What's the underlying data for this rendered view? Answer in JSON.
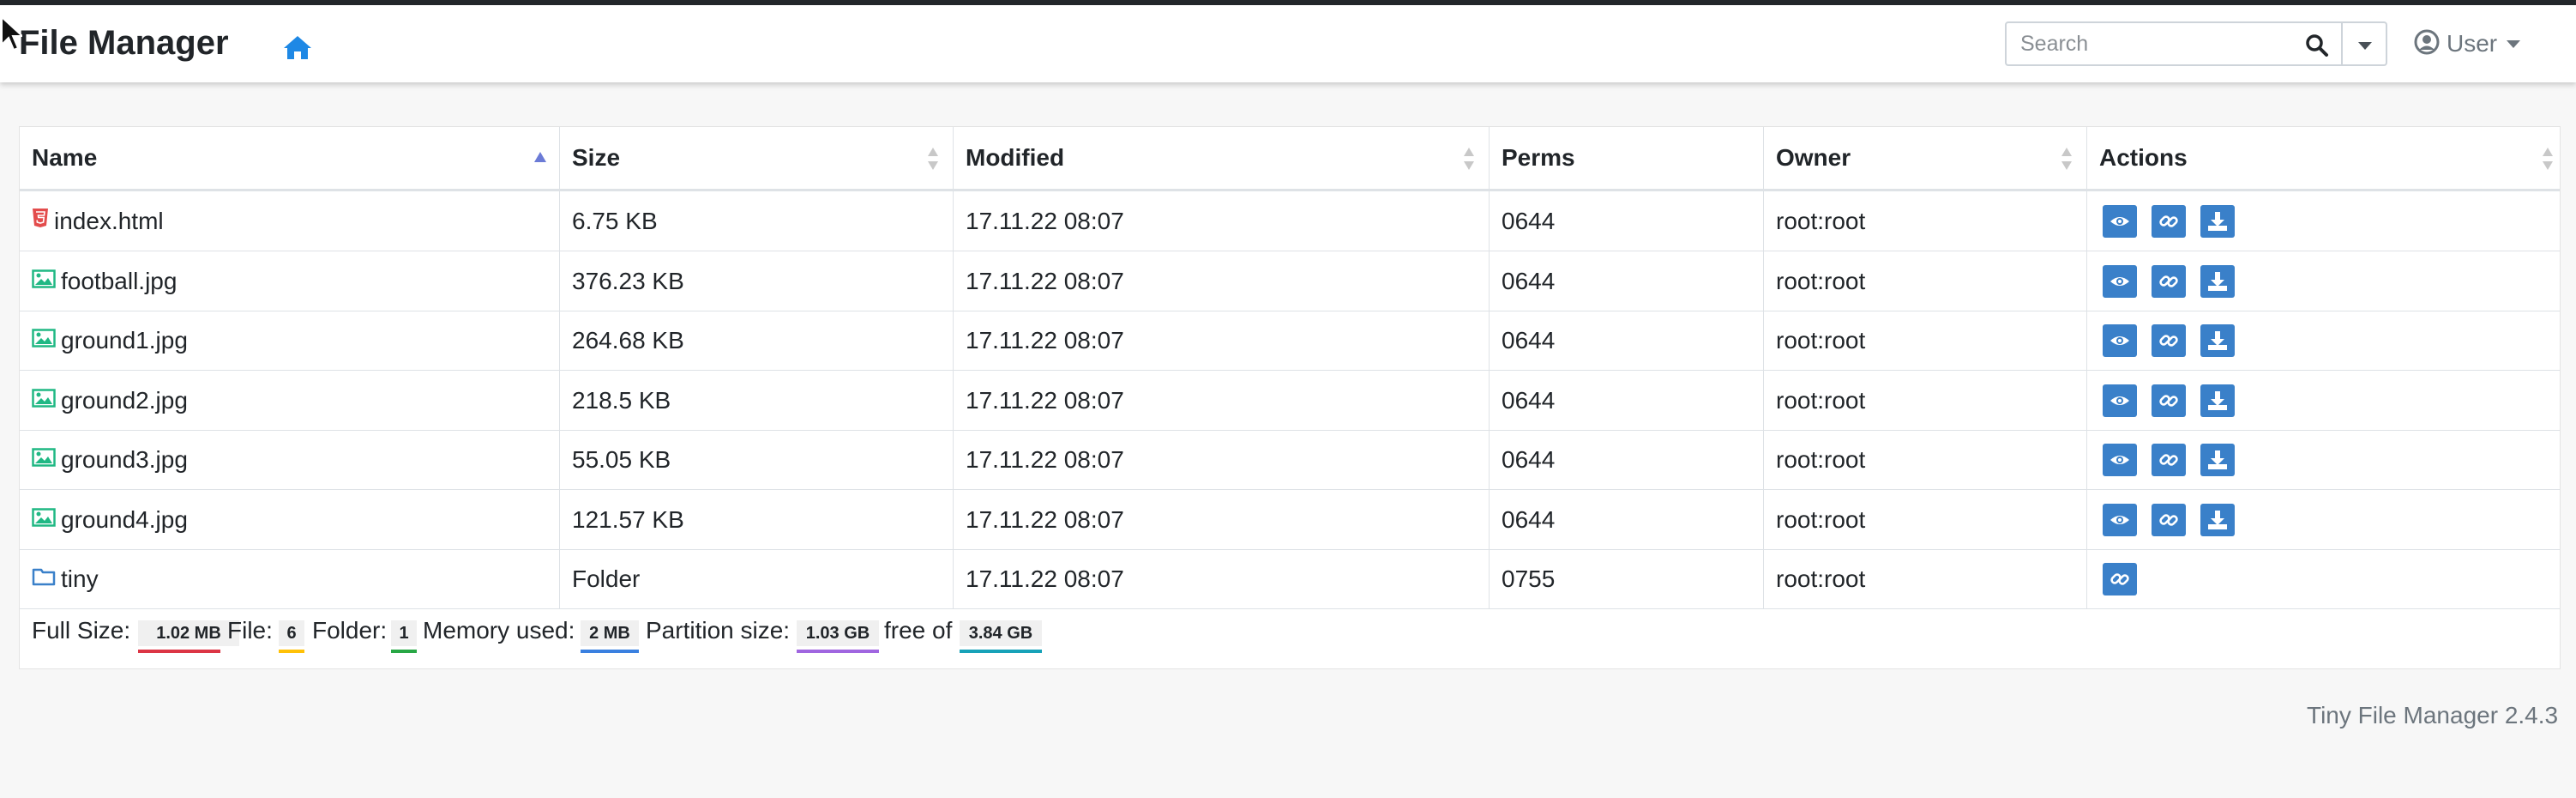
{
  "app": {
    "title": "File Manager"
  },
  "search": {
    "placeholder": "Search",
    "value": ""
  },
  "user_menu": {
    "label": "User"
  },
  "table": {
    "headers": {
      "name": "Name",
      "size": "Size",
      "modified": "Modified",
      "perms": "Perms",
      "owner": "Owner",
      "actions": "Actions"
    },
    "rows": [
      {
        "icon": "html-file-icon",
        "name": "index.html",
        "size": "6.75 KB",
        "modified": "17.11.22 08:07",
        "perms": "0644",
        "owner": "root:root"
      },
      {
        "icon": "image-file-icon",
        "name": "football.jpg",
        "size": "376.23 KB",
        "modified": "17.11.22 08:07",
        "perms": "0644",
        "owner": "root:root"
      },
      {
        "icon": "image-file-icon",
        "name": "ground1.jpg",
        "size": "264.68 KB",
        "modified": "17.11.22 08:07",
        "perms": "0644",
        "owner": "root:root"
      },
      {
        "icon": "image-file-icon",
        "name": "ground2.jpg",
        "size": "218.5 KB",
        "modified": "17.11.22 08:07",
        "perms": "0644",
        "owner": "root:root"
      },
      {
        "icon": "image-file-icon",
        "name": "ground3.jpg",
        "size": "55.05 KB",
        "modified": "17.11.22 08:07",
        "perms": "0644",
        "owner": "root:root"
      },
      {
        "icon": "image-file-icon",
        "name": "ground4.jpg",
        "size": "121.57 KB",
        "modified": "17.11.22 08:07",
        "perms": "0644",
        "owner": "root:root"
      },
      {
        "icon": "folder-icon",
        "name": "tiny",
        "size": "Folder",
        "modified": "17.11.22 08:07",
        "perms": "0755",
        "owner": "root:root"
      }
    ]
  },
  "summary": {
    "full_size_label": "Full Size:",
    "full_size": "1.02 MB",
    "file_label": "File:",
    "file_count": "6",
    "folder_label": "Folder:",
    "folder_count": "1",
    "memory_label": "Memory used:",
    "memory": "2 MB",
    "partition_label": "Partition size:",
    "partition": "1.03 GB",
    "free_label": "free of",
    "total": "3.84 GB"
  },
  "footer": {
    "version": "Tiny File Manager 2.4.3"
  },
  "colors": {
    "accent": "#3a80c9",
    "home": "#1e88e5",
    "html_icon": "#e34c4c",
    "image_icon": "#20b884",
    "folder_icon": "#3a80c9",
    "badge_full": "#dc3545",
    "badge_file": "#ffc107",
    "badge_folder": "#28a745",
    "badge_memory": "#3a80e0",
    "badge_partition": "#a066e0",
    "badge_total": "#17a2b8"
  }
}
